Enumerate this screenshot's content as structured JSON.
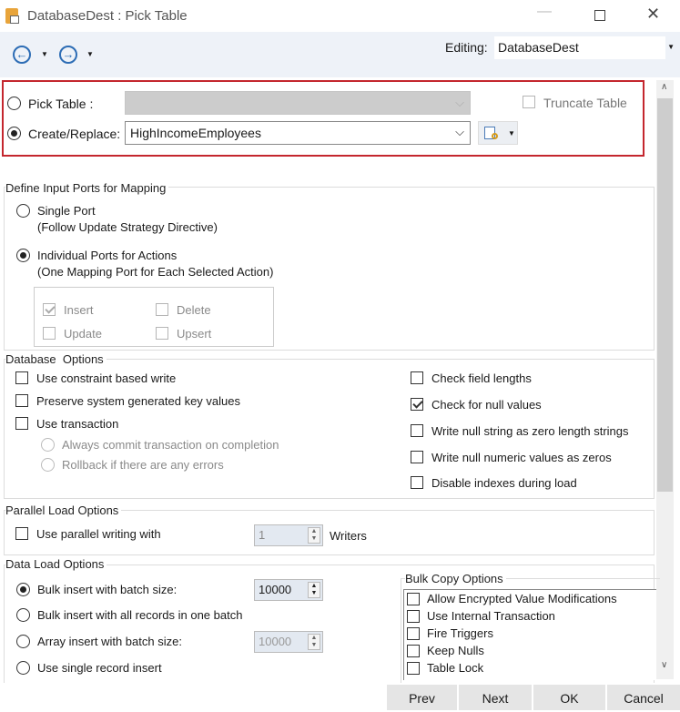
{
  "window": {
    "title": "DatabaseDest : Pick Table"
  },
  "toolbar": {
    "editing_label": "Editing:",
    "editing_value": "DatabaseDest"
  },
  "table_pick": {
    "pick_table_label": "Pick Table :",
    "create_replace_label": "Create/Replace:",
    "create_replace_value": "HighIncomeEmployees",
    "truncate_label": "Truncate Table"
  },
  "input_ports": {
    "title": "Define Input Ports for Mapping",
    "single_port": "Single Port",
    "single_port_sub": "(Follow Update Strategy Directive)",
    "individual": "Individual Ports for Actions",
    "individual_sub": "(One Mapping Port for Each Selected Action)",
    "insert": "Insert",
    "delete": "Delete",
    "update": "Update",
    "upsert": "Upsert"
  },
  "db_options": {
    "title": "Database  Options",
    "constraint": "Use constraint based write",
    "preserve": "Preserve system generated key values",
    "transaction": "Use transaction",
    "always_commit": "Always commit transaction on completion",
    "rollback": "Rollback if there are any errors",
    "check_lengths": "Check field lengths",
    "check_null": "Check for null values",
    "null_string": "Write null string as zero length strings",
    "null_numeric": "Write null numeric values as zeros",
    "disable_indexes": "Disable indexes during load"
  },
  "parallel": {
    "title": "Parallel Load Options",
    "use_parallel": "Use parallel writing with",
    "writers_value": "1",
    "writers_label": "Writers"
  },
  "data_load": {
    "title": "Data Load Options",
    "bulk_batch": "Bulk insert with batch size:",
    "bulk_batch_value": "10000",
    "bulk_all": "Bulk insert with all records in one batch",
    "array_batch": "Array insert with batch size:",
    "array_batch_value": "10000",
    "single": "Use single record insert"
  },
  "bulk_copy": {
    "title": "Bulk Copy Options",
    "items": [
      "Allow Encrypted Value Modifications",
      "Use Internal Transaction",
      "Fire Triggers",
      "Keep Nulls",
      "Table Lock"
    ]
  },
  "buttons": {
    "prev": "Prev",
    "next": "Next",
    "ok": "OK",
    "cancel": "Cancel"
  }
}
